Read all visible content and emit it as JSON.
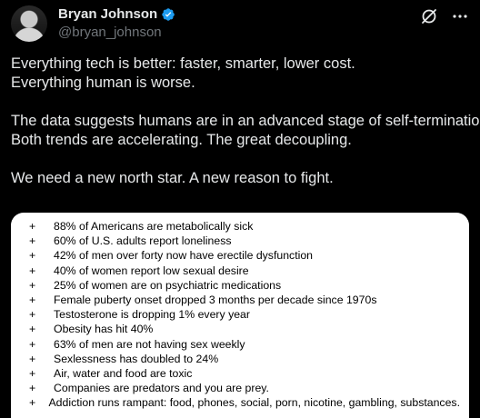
{
  "author": {
    "display_name": "Bryan Johnson",
    "handle": "@bryan_johnson"
  },
  "icons": {
    "avatar": "avatar-photo",
    "verified": "verified-badge-icon",
    "grok": "grok-icon",
    "more": "more-icon"
  },
  "colors": {
    "background": "#000000",
    "text": "#e7e9ea",
    "secondary": "#71767b",
    "verified": "#1d9bf0",
    "card": "#ffffff"
  },
  "tweet": {
    "lines": [
      "Everything tech is better: faster, smarter, lower cost.",
      "Everything human is worse.",
      "",
      "The data suggests humans are in an advanced stage of self-termination.",
      "Both trends are accelerating. The great decoupling.",
      "",
      "We need a new north star. A new reason to fight."
    ]
  },
  "media": {
    "bullet": "+",
    "items": [
      "88% of Americans are metabolically sick",
      "60% of U.S. adults report loneliness",
      "42% of men over forty now have erectile dysfunction",
      "40% of women report low sexual desire",
      "25% of women are on psychiatric medications",
      "Female puberty onset dropped 3 months per decade since 1970s",
      "Testosterone is dropping 1% every year",
      "Obesity has hit 40%",
      "63% of men are not having sex weekly",
      "Sexlessness has doubled to 24%",
      "Air, water and food are toxic",
      "Companies are predators and you are prey.",
      "Addiction runs rampant: food, phones, social, porn, nicotine, gambling, substances."
    ]
  }
}
